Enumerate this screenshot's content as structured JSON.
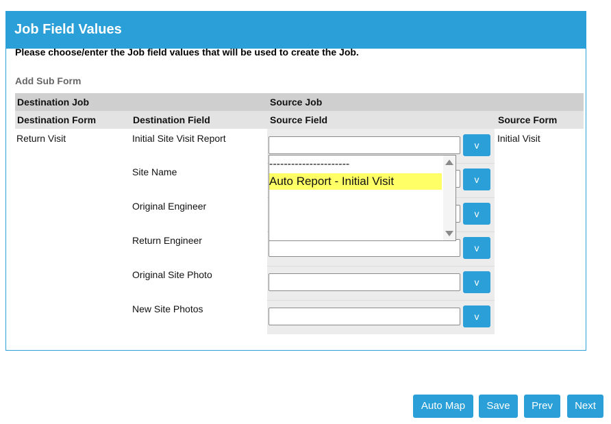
{
  "panel": {
    "title": "Job Field Values",
    "instructions": "Please choose/enter the Job field values that will be used to create the Job.",
    "add_sub_form": "Add Sub Form"
  },
  "table": {
    "group_headers": {
      "destination_job": "Destination Job",
      "source_job": "Source Job"
    },
    "column_headers": {
      "destination_form": "Destination Form",
      "destination_field": "Destination Field",
      "source_field": "Source Field",
      "source_form": "Source Form"
    },
    "destination_form": "Return Visit",
    "source_form": "Initial Visit",
    "rows": [
      {
        "destination_field": "Initial Site Visit Report",
        "source_value": "",
        "button": "v"
      },
      {
        "destination_field": "Site Name",
        "source_value": "",
        "button": "v"
      },
      {
        "destination_field": "Original Engineer",
        "source_value": "",
        "button": "v"
      },
      {
        "destination_field": "Return Engineer",
        "source_value": "",
        "button": "v"
      },
      {
        "destination_field": "Original Site Photo",
        "source_value": "",
        "button": "v"
      },
      {
        "destination_field": "New Site Photos",
        "source_value": "",
        "button": "v"
      }
    ]
  },
  "dropdown": {
    "options": [
      "----------------------",
      "Auto Report - Initial Visit"
    ],
    "highlighted": "Auto Report - Initial Visit",
    "highlight_color": "#ffff66"
  },
  "footer": {
    "auto_map": "Auto Map",
    "save": "Save",
    "prev": "Prev",
    "next": "Next"
  },
  "colors": {
    "accent": "#2a9fd8"
  }
}
